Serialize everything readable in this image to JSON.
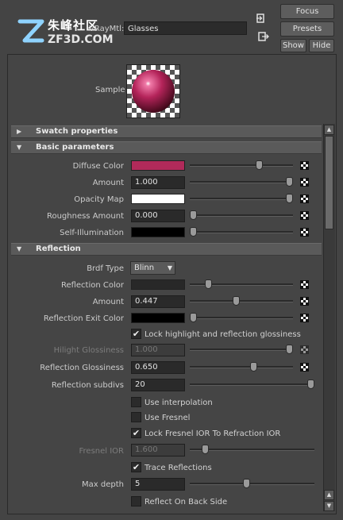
{
  "watermark": {
    "cn_text": "朱峰社区",
    "en_text": "ZF3D.COM"
  },
  "header": {
    "material_label": "VRayMtl:",
    "material_name": "Glasses",
    "buttons": {
      "focus": "Focus",
      "presets": "Presets",
      "show": "Show",
      "hide": "Hide"
    }
  },
  "sample": {
    "label": "Sample"
  },
  "sections": {
    "swatch": "Swatch properties",
    "basic": "Basic parameters",
    "reflection": "Reflection"
  },
  "basic": {
    "diffuse_color": {
      "label": "Diffuse Color",
      "color": "#b12a5a",
      "slider": 0.69
    },
    "amount": {
      "label": "Amount",
      "value": "1.000",
      "slider": 1.0
    },
    "opacity_map": {
      "label": "Opacity Map",
      "color": "#ffffff",
      "slider": 1.0
    },
    "roughness": {
      "label": "Roughness Amount",
      "value": "0.000",
      "slider": 0.0
    },
    "self_illum": {
      "label": "Self-Illumination",
      "color": "#000000",
      "slider": 0.0
    }
  },
  "reflection": {
    "brdf_type": {
      "label": "Brdf Type",
      "value": "Blinn"
    },
    "reflection_color": {
      "label": "Reflection Color",
      "color": "#282828",
      "slider": 0.16
    },
    "amount": {
      "label": "Amount",
      "value": "0.447",
      "slider": 0.45
    },
    "exit_color": {
      "label": "Reflection Exit Color",
      "color": "#000000",
      "slider": 0.0
    },
    "lock_hl": {
      "label": "Lock highlight and reflection glossiness",
      "checked": true
    },
    "hilight_gloss": {
      "label": "Hilight Glossiness",
      "value": "1.000",
      "slider": 1.0
    },
    "refl_gloss": {
      "label": "Reflection Glossiness",
      "value": "0.650",
      "slider": 0.63
    },
    "subdivs": {
      "label": "Reflection subdivs",
      "value": "20",
      "slider": 1.0
    },
    "use_interp": {
      "label": "Use interpolation",
      "checked": false
    },
    "use_fresnel": {
      "label": "Use Fresnel",
      "checked": false
    },
    "lock_fresnel": {
      "label": "Lock Fresnel IOR To Refraction IOR",
      "checked": true
    },
    "fresnel_ior": {
      "label": "Fresnel IOR",
      "value": "1.600",
      "slider": 0.1
    },
    "trace": {
      "label": "Trace Reflections",
      "checked": true
    },
    "max_depth": {
      "label": "Max depth",
      "value": "5",
      "slider": 0.45
    },
    "back_side": {
      "label": "Reflect On Back Side",
      "checked": false
    }
  },
  "colors": {
    "panel": "#454545",
    "section_header": "#5a5a5a",
    "field": "#2a2a2a"
  }
}
